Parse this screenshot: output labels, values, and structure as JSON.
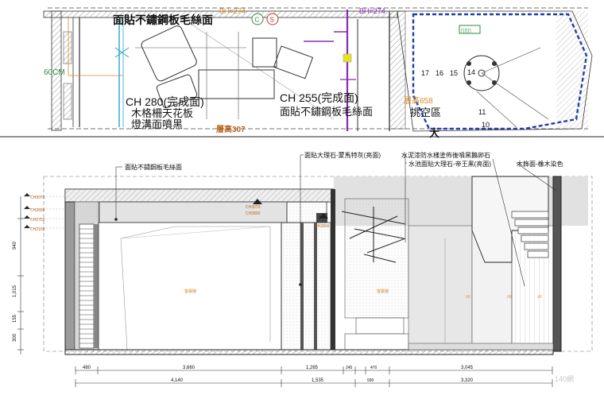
{
  "plan": {
    "title": "面貼不鏽鋼板毛絲面",
    "tag_top_a": "BH=274",
    "tag_top_b": "BH=274",
    "dim_left": "60CM",
    "ceiling_note_1": {
      "height": "CH 280(完成面)",
      "line1": "木格柵天花板",
      "line2": "燈溝面噴黑"
    },
    "ceiling_note_2": {
      "height": "CH 255(完成面)",
      "line1": "面貼不鏽鋼板毛絲面"
    },
    "floor_level": "層高307",
    "void_level": "層高658",
    "void_label": "挑空區",
    "stair_numbers": [
      "17",
      "16",
      "15",
      "14",
      "11",
      "10"
    ],
    "corner_char": "大"
  },
  "elevation": {
    "callouts": [
      "面貼不鏽鋼板毛絲面",
      "面貼大理石-蒙馬特灰(亮面)",
      "水泥漆防水樣塗佈後噴黑鵝卵石",
      "水池面貼大理石-帝王黑(亮面)",
      "木飾面-橡木染色"
    ],
    "left_levels": [
      "CH3070",
      "CH2800",
      "CH2750",
      "CH2100"
    ],
    "ceiling_tags": [
      "CH3070",
      "CH2800",
      "CH2800"
    ],
    "vertical_dims": [
      "940",
      "1,015",
      "155",
      "300"
    ],
    "room_labels": [
      "客廳牆",
      "客廳牆",
      "±0",
      "±0",
      "±0"
    ],
    "bottom_dims_row1": [
      "480",
      "3,660",
      "1,265",
      "245",
      "470",
      "3,045"
    ],
    "bottom_dims_row2": [
      "4,140",
      "1,535",
      "590",
      "3,320"
    ]
  },
  "watermark": "140網"
}
